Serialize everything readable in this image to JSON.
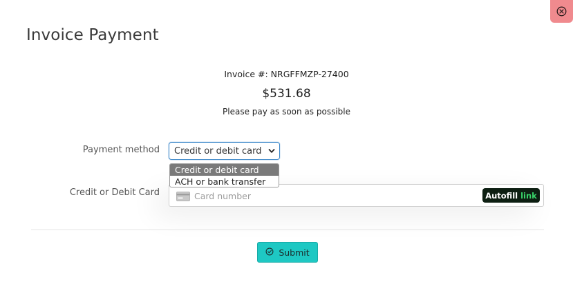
{
  "header": {
    "title": "Invoice Payment"
  },
  "invoice": {
    "number_text": "Invoice #: NRGFFMZP-27400",
    "amount": "$531.68",
    "note": "Please pay as soon as possible"
  },
  "payment_method": {
    "label": "Payment method",
    "selected": "Credit or debit card",
    "options": [
      "Credit or debit card",
      "ACH or bank transfer"
    ]
  },
  "card": {
    "label": "Credit or Debit Card",
    "placeholder": "Card number",
    "value": "",
    "autofill_label": "Autofill",
    "autofill_link": "link"
  },
  "actions": {
    "submit_label": "Submit"
  },
  "icons": {
    "close": "close-icon",
    "chevron": "chevron-down-icon",
    "card": "credit-card-icon",
    "submit": "check-circle-icon"
  },
  "colors": {
    "close_bg": "#f08a8e",
    "select_border": "#3a86c8",
    "submit_bg": "#1ec8c3",
    "autofill_bg": "#0d1f12",
    "autofill_link": "#39d46a",
    "dropdown_selected_bg": "#7a7a7a"
  }
}
